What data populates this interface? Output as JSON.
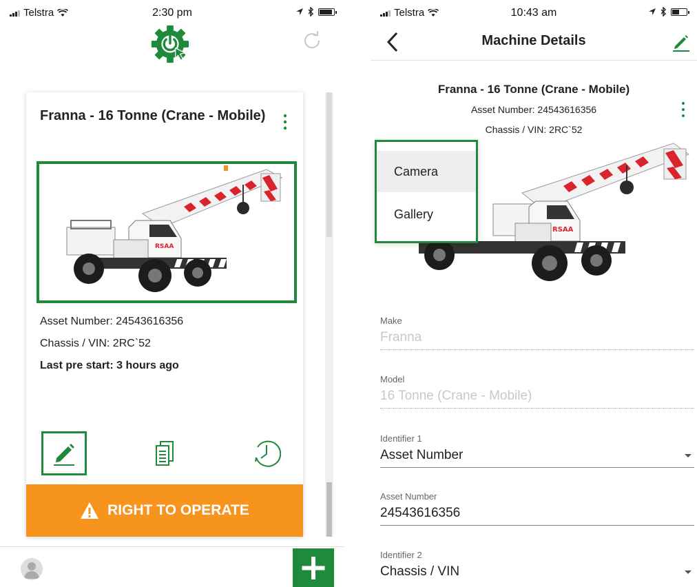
{
  "left": {
    "status": {
      "carrier": "Telstra",
      "time": "2:30 pm"
    },
    "card": {
      "title": "Franna - 16 Tonne (Crane - Mobile)",
      "asset_number": "Asset Number: 24543616356",
      "chassis": "Chassis / VIN: 2RC`52",
      "last_prestart": "Last pre start: 3 hours ago",
      "operate_label": "RIGHT TO OPERATE"
    }
  },
  "right": {
    "status": {
      "carrier": "Telstra",
      "time": "10:43 am"
    },
    "nav_title": "Machine Details",
    "header": {
      "title": "Franna - 16 Tonne (Crane - Mobile)",
      "asset_number": "Asset Number: 24543616356",
      "chassis": "Chassis / VIN: 2RC`52"
    },
    "photo_menu": [
      "Camera",
      "Gallery"
    ],
    "fields": [
      {
        "label": "Make",
        "value": "Franna"
      },
      {
        "label": "Model",
        "value": "16 Tonne (Crane - Mobile)"
      },
      {
        "label": "Identifier 1",
        "value": "Asset Number"
      },
      {
        "label": "Asset Number",
        "value": "24543616356"
      },
      {
        "label": "Identifier 2",
        "value": "Chassis / VIN"
      }
    ]
  },
  "colors": {
    "brand_green": "#1f8a3c",
    "operate_orange": "#f7941d"
  },
  "icons": [
    "gear-power-logo-icon",
    "refresh-icon",
    "more-vertical-icon",
    "pencil-icon",
    "documents-icon",
    "clock-history-icon",
    "warning-icon",
    "avatar-icon",
    "plus-icon",
    "back-chevron-icon",
    "dropdown-caret-icon"
  ]
}
